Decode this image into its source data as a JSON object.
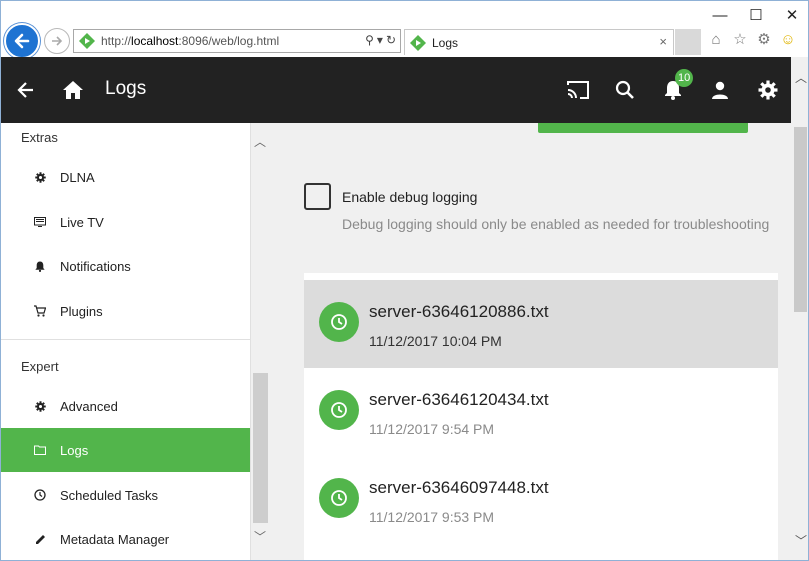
{
  "browser": {
    "url_prefix": "http://",
    "url_host": "localhost",
    "url_rest": ":8096/web/log.html",
    "tab_title": "Logs",
    "tab_close": "×",
    "window_controls": {
      "minimize": "—",
      "maximize": "☐",
      "close": "✕"
    }
  },
  "header": {
    "title": "Logs",
    "notification_count": "10"
  },
  "sidebar": {
    "sections": [
      {
        "heading": "Extras"
      },
      {
        "heading": "Expert"
      }
    ],
    "items": [
      {
        "label": "DLNA",
        "icon": "gear-icon"
      },
      {
        "label": "Live TV",
        "icon": "tv-icon"
      },
      {
        "label": "Notifications",
        "icon": "bell-icon"
      },
      {
        "label": "Plugins",
        "icon": "cart-icon"
      },
      {
        "label": "Advanced",
        "icon": "gear-icon"
      },
      {
        "label": "Logs",
        "icon": "folder-icon",
        "active": true
      },
      {
        "label": "Scheduled Tasks",
        "icon": "clock-icon"
      },
      {
        "label": "Metadata Manager",
        "icon": "pencil-icon"
      }
    ]
  },
  "main": {
    "debug_label": "Enable debug logging",
    "debug_help": "Debug logging should only be enabled as needed for troubleshooting",
    "debug_checked": false,
    "logs": [
      {
        "name": "server-63646120886.txt",
        "date": "11/12/2017 10:04 PM",
        "selected": true
      },
      {
        "name": "server-63646120434.txt",
        "date": "11/12/2017 9:54 PM",
        "selected": false
      },
      {
        "name": "server-63646097448.txt",
        "date": "11/12/2017 9:53 PM",
        "selected": false
      }
    ]
  },
  "colors": {
    "accent": "#52b54b",
    "header_bg": "#222222",
    "browser_back": "#1e73d2"
  }
}
